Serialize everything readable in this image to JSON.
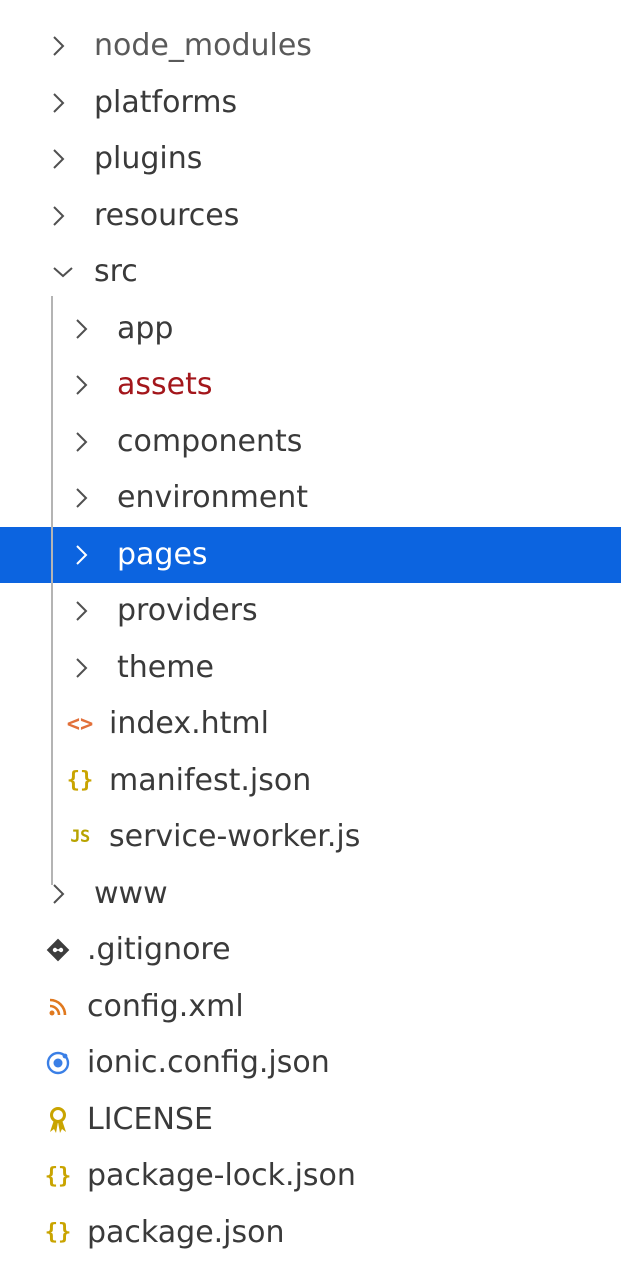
{
  "tree": {
    "items": [
      {
        "label": "node_modules",
        "kind": "folder",
        "expanded": false
      },
      {
        "label": "platforms",
        "kind": "folder",
        "expanded": false
      },
      {
        "label": "plugins",
        "kind": "folder",
        "expanded": false
      },
      {
        "label": "resources",
        "kind": "folder",
        "expanded": false
      },
      {
        "label": "src",
        "kind": "folder",
        "expanded": true
      },
      {
        "label": "app",
        "kind": "folder",
        "expanded": false
      },
      {
        "label": "assets",
        "kind": "folder",
        "expanded": false
      },
      {
        "label": "components",
        "kind": "folder",
        "expanded": false
      },
      {
        "label": "environment",
        "kind": "folder",
        "expanded": false
      },
      {
        "label": "pages",
        "kind": "folder",
        "expanded": false,
        "selected": true
      },
      {
        "label": "providers",
        "kind": "folder",
        "expanded": false
      },
      {
        "label": "theme",
        "kind": "folder",
        "expanded": false
      },
      {
        "label": "index.html",
        "kind": "file",
        "icon": "html-icon",
        "icon_glyph": "<>"
      },
      {
        "label": "manifest.json",
        "kind": "file",
        "icon": "json-icon",
        "icon_glyph": "{}"
      },
      {
        "label": "service-worker.js",
        "kind": "file",
        "icon": "js-icon",
        "icon_glyph": "JS"
      },
      {
        "label": "www",
        "kind": "folder",
        "expanded": false
      },
      {
        "label": ".gitignore",
        "kind": "file",
        "icon": "git-icon"
      },
      {
        "label": "config.xml",
        "kind": "file",
        "icon": "rss-icon"
      },
      {
        "label": "ionic.config.json",
        "kind": "file",
        "icon": "ionic-icon"
      },
      {
        "label": "LICENSE",
        "kind": "file",
        "icon": "license-icon"
      },
      {
        "label": "package-lock.json",
        "kind": "file",
        "icon": "json-icon",
        "icon_glyph": "{}"
      },
      {
        "label": "package.json",
        "kind": "file",
        "icon": "json-icon",
        "icon_glyph": "{}"
      }
    ]
  },
  "colors": {
    "selection": "#0c64e0",
    "text": "#3a3a3a",
    "highlight_text": "#a3161b",
    "indent_guide": "#b4b4b4",
    "html_icon": "#e2703a",
    "json_icon": "#c9a400",
    "js_icon": "#b8a300",
    "git_icon": "#3d3d3d",
    "rss_icon": "#e0791f",
    "ionic_icon": "#3a7fe6",
    "license_icon": "#c9a400"
  }
}
